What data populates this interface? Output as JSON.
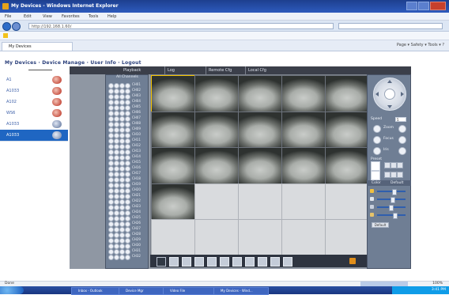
{
  "window": {
    "title": "My Devices - Windows Internet Explorer",
    "menu": [
      "File",
      "Edit",
      "View",
      "Favorites",
      "Tools",
      "Help"
    ]
  },
  "address": {
    "url": "http://192.168.1.60/",
    "search_placeholder": ""
  },
  "browser": {
    "tab_label": "My Devices",
    "tools": "Page ▾   Safety ▾   Tools ▾   ?"
  },
  "topnav": {
    "text": "My Devices · Device Manage · User Info · Logout"
  },
  "devices": [
    {
      "label": "A1",
      "selected": false
    },
    {
      "label": "A1033",
      "selected": false
    },
    {
      "label": "A102",
      "selected": false
    },
    {
      "label": "WS6",
      "selected": false
    },
    {
      "label": "A1033",
      "selected": false
    },
    {
      "label": "A1033",
      "selected": true
    }
  ],
  "header": {
    "playback": "Playback",
    "log": "Log",
    "remote": "Remote Cfg",
    "local": "Local Cfg"
  },
  "channel_panel": {
    "title": "All Channels",
    "channels": [
      "CH01",
      "CH02",
      "CH03",
      "CH04",
      "CH05",
      "CH06",
      "CH07",
      "CH08",
      "CH09",
      "CH10",
      "CH11",
      "CH12",
      "CH13",
      "CH14",
      "CH15",
      "CH16",
      "CH17",
      "CH18",
      "CH19",
      "CH20",
      "CH21",
      "CH22",
      "CH23",
      "CH24",
      "CH25",
      "CH26",
      "CH27",
      "CH28",
      "CH29",
      "CH30",
      "CH31",
      "CH32"
    ]
  },
  "video_grid": {
    "rows": 5,
    "cols": 5,
    "live": [
      true,
      true,
      true,
      true,
      true,
      true,
      true,
      true,
      true,
      true,
      true,
      true,
      true,
      true,
      true,
      true,
      false,
      false,
      false,
      false,
      false,
      false,
      false,
      false,
      false
    ]
  },
  "ptz": {
    "speed_label": "Speed",
    "speed_value": "5",
    "controls": [
      "Zoom",
      "Focus",
      "Iris"
    ],
    "preset_label": "Preset"
  },
  "color": {
    "left": "Color",
    "right": "Default",
    "default_button": "Default",
    "sliders": [
      0.55,
      0.5,
      0.45,
      0.6
    ]
  },
  "status": {
    "left": "Done",
    "zoom": "100%"
  },
  "taskbar": {
    "tasks": [
      "Inbox - Outlook",
      "Device Mgr",
      "Video File",
      "My Devices - Wind..."
    ],
    "clock": "3:41 PM"
  }
}
